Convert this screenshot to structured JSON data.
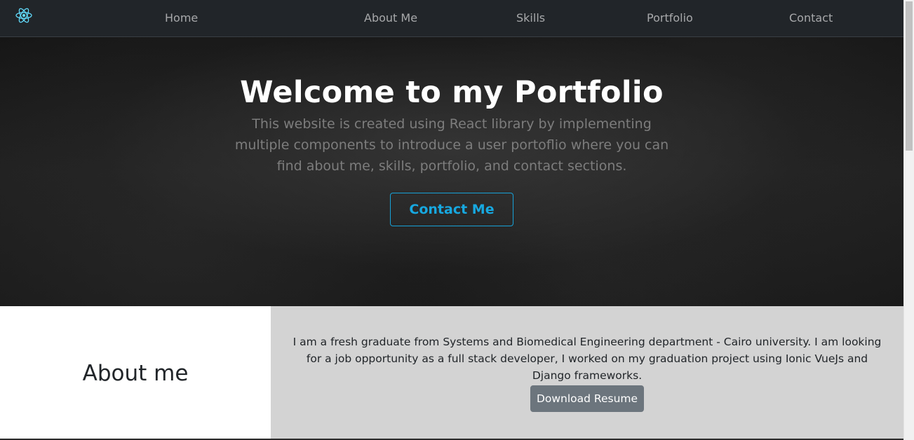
{
  "nav": {
    "logo_icon": "react-atom-icon",
    "logo_color": "#61dafb",
    "links": [
      {
        "label": "Home"
      },
      {
        "label": "About Me"
      },
      {
        "label": "Skills"
      },
      {
        "label": "Portfolio"
      },
      {
        "label": "Contact"
      }
    ]
  },
  "hero": {
    "title": "Welcome to my Portfolio",
    "description": "This website is created using React library by implementing multiple components to introduce a user portoflio where you can find about me, skills, portfolio, and contact sections.",
    "button_label": "Contact Me",
    "accent_color": "#17a8e0"
  },
  "about": {
    "title": "About me",
    "text": "I am a fresh graduate from Systems and Biomedical Engineering department - Cairo university. I am looking for a job opportunity as a full stack developer, I worked on my graduation project using Ionic VueJs and Django frameworks.",
    "button_label": "Download Resume"
  }
}
